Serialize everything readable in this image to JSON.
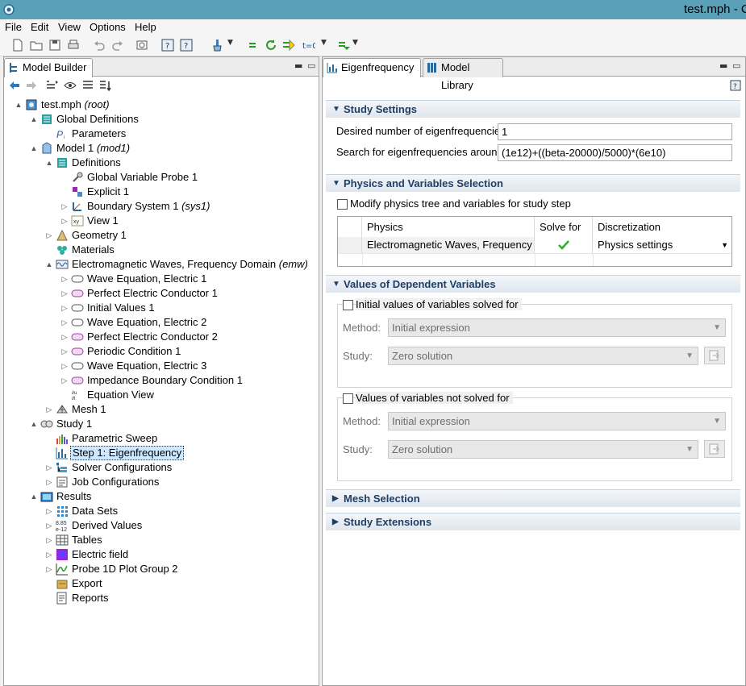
{
  "window": {
    "title": "test.mph - C"
  },
  "menu": [
    "File",
    "Edit",
    "View",
    "Options",
    "Help"
  ],
  "left_panel": {
    "tab_label": "Model Builder"
  },
  "tree": [
    {
      "label": "test.mph",
      "suffix": "(root)",
      "arrow": "▲",
      "icon": "file-icon"
    },
    {
      "label": "Global Definitions",
      "arrow": "▲",
      "icon": "definitions-icon"
    },
    {
      "label": "Parameters",
      "arrow": "",
      "icon": "parameters-icon"
    },
    {
      "label": "Model 1",
      "suffix": "(mod1)",
      "arrow": "▲",
      "icon": "model-icon"
    },
    {
      "label": "Definitions",
      "arrow": "▲",
      "icon": "definitions-icon"
    },
    {
      "label": "Global Variable Probe 1",
      "arrow": "",
      "icon": "probe-icon"
    },
    {
      "label": "Explicit 1",
      "arrow": "",
      "icon": "explicit-icon"
    },
    {
      "label": "Boundary System 1",
      "suffix": "(sys1)",
      "arrow": "▷",
      "icon": "boundary-system-icon"
    },
    {
      "label": "View 1",
      "arrow": "▷",
      "icon": "view-icon"
    },
    {
      "label": "Geometry 1",
      "arrow": "▷",
      "icon": "geometry-icon"
    },
    {
      "label": "Materials",
      "arrow": "",
      "icon": "materials-icon"
    },
    {
      "label": "Electromagnetic Waves, Frequency Domain",
      "suffix": "(emw)",
      "arrow": "▲",
      "icon": "emw-icon"
    },
    {
      "label": "Wave Equation, Electric 1",
      "arrow": "▷",
      "icon": "domain-node-icon"
    },
    {
      "label": "Perfect Electric Conductor 1",
      "arrow": "▷",
      "icon": "boundary-node-icon"
    },
    {
      "label": "Initial Values 1",
      "arrow": "▷",
      "icon": "domain-node-icon"
    },
    {
      "label": "Wave Equation, Electric 2",
      "arrow": "▷",
      "icon": "domain-node-icon"
    },
    {
      "label": "Perfect Electric Conductor 2",
      "arrow": "▷",
      "icon": "boundary-node-icon"
    },
    {
      "label": "Periodic Condition 1",
      "arrow": "▷",
      "icon": "boundary-node-icon"
    },
    {
      "label": "Wave Equation, Electric 3",
      "arrow": "▷",
      "icon": "domain-node-icon"
    },
    {
      "label": "Impedance Boundary Condition 1",
      "arrow": "▷",
      "icon": "boundary-node-icon"
    },
    {
      "label": "Equation View",
      "arrow": "",
      "icon": "equation-view-icon"
    },
    {
      "label": "Mesh 1",
      "arrow": "▷",
      "icon": "mesh-icon"
    },
    {
      "label": "Study 1",
      "arrow": "▲",
      "icon": "study-icon"
    },
    {
      "label": "Parametric Sweep",
      "arrow": "",
      "icon": "parametric-sweep-icon"
    },
    {
      "label": "Step 1: Eigenfrequency",
      "arrow": "",
      "icon": "eigenfrequency-icon",
      "selected": true
    },
    {
      "label": "Solver Configurations",
      "arrow": "▷",
      "icon": "solver-icon"
    },
    {
      "label": "Job Configurations",
      "arrow": "▷",
      "icon": "job-icon"
    },
    {
      "label": "Results",
      "arrow": "▲",
      "icon": "results-icon"
    },
    {
      "label": "Data Sets",
      "arrow": "▷",
      "icon": "datasets-icon"
    },
    {
      "label": "Derived Values",
      "arrow": "▷",
      "icon": "derived-values-icon"
    },
    {
      "label": "Tables",
      "arrow": "▷",
      "icon": "tables-icon"
    },
    {
      "label": "Electric field",
      "arrow": "▷",
      "icon": "plot-group-icon"
    },
    {
      "label": "Probe 1D Plot Group 2",
      "arrow": "▷",
      "icon": "probe-plot-icon"
    },
    {
      "label": "Export",
      "arrow": "",
      "icon": "export-icon"
    },
    {
      "label": "Reports",
      "arrow": "",
      "icon": "reports-icon"
    }
  ],
  "right_panel": {
    "tabs": [
      "Eigenfrequency",
      "Model Library"
    ],
    "study_settings": {
      "header": "Study Settings",
      "desired_label": "Desired number of eigenfrequencies:",
      "desired_value": "1",
      "search_label": "Search for eigenfrequencies around:",
      "search_value": "(1e12)+((beta-20000)/5000)*(6e10)"
    },
    "physics": {
      "header": "Physics and Variables Selection",
      "modify_label": "Modify physics tree and variables for study step",
      "columns": [
        "Physics",
        "Solve for",
        "Discretization"
      ],
      "row": {
        "physics": "Electromagnetic Waves, Frequency ...",
        "discretization": "Physics settings"
      }
    },
    "dependent": {
      "header": "Values of Dependent Variables",
      "group1_label": "Initial values of variables solved for",
      "group2_label": "Values of variables not solved for",
      "method_label": "Method:",
      "method_value": "Initial expression",
      "study_label": "Study:",
      "study_value": "Zero solution"
    },
    "mesh_header": "Mesh Selection",
    "extensions_header": "Study Extensions"
  }
}
